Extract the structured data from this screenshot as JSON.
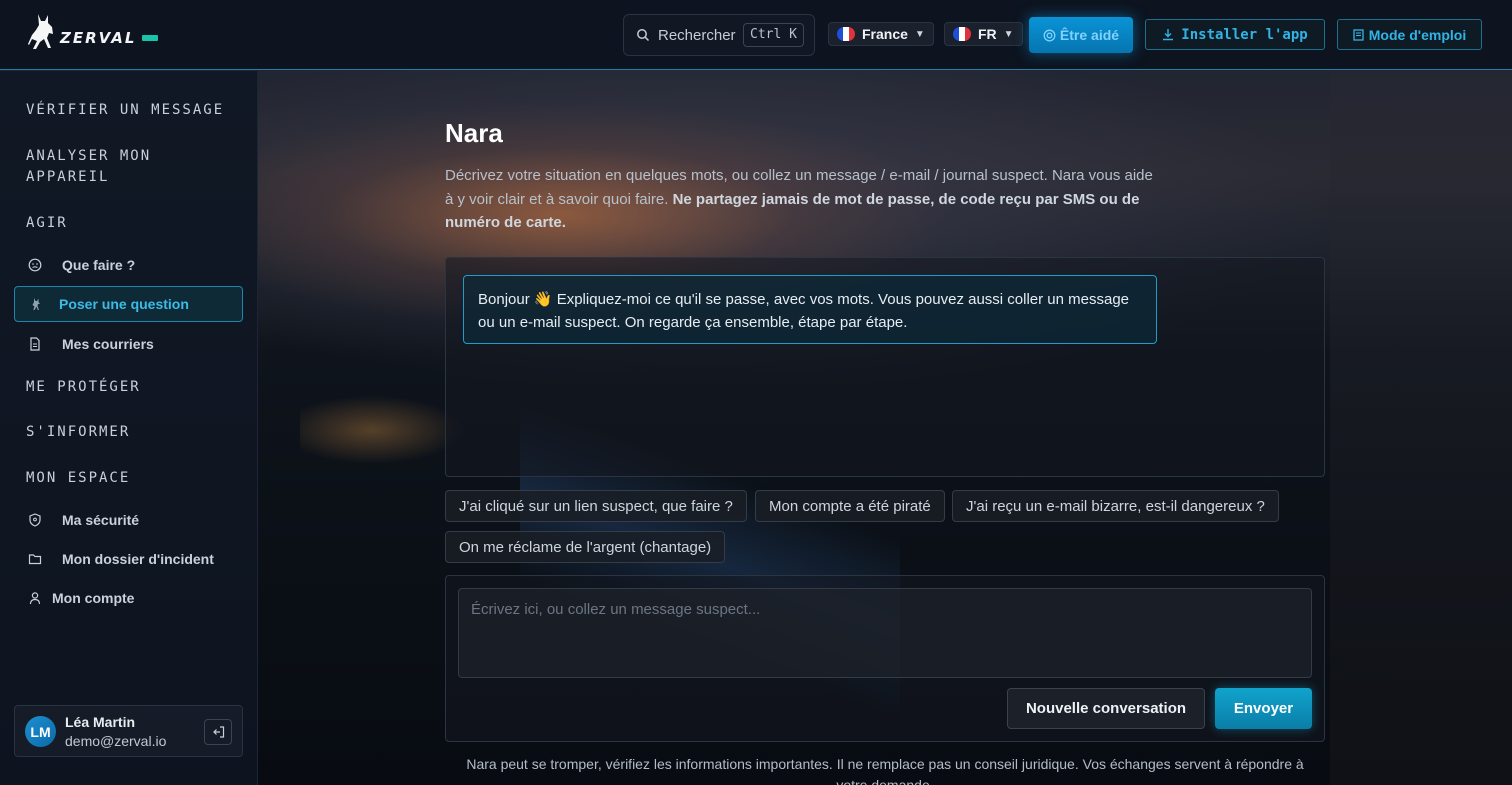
{
  "header": {
    "brand": "ZERVAL",
    "search": {
      "label": "Rechercher",
      "shortcut": "Ctrl K"
    },
    "country": {
      "label": "France",
      "flag": [
        "#1e4fd8",
        "#ffffff",
        "#e2323a"
      ]
    },
    "language": {
      "label": "FR",
      "flag": [
        "#1e4fd8",
        "#ffffff",
        "#e2323a"
      ]
    },
    "help_button": "Être aidé",
    "install_button": "Installer l'app",
    "manual_button": "Mode d'emploi"
  },
  "sidebar": {
    "sections": {
      "verify": "VÉRIFIER UN MESSAGE",
      "analyze_line1": "ANALYSER MON",
      "analyze_line2": "APPAREIL",
      "act": "AGIR",
      "protect": "ME PROTÉGER",
      "inform": "S'INFORMER",
      "space": "MON ESPACE"
    },
    "items": {
      "what_to_do": "Que faire ?",
      "ask_question": "Poser une question",
      "my_mail": "Mes courriers",
      "my_security": "Ma sécurité",
      "incident_file": "Mon dossier d'incident",
      "my_account": "Mon compte"
    },
    "user": {
      "initials": "LM",
      "name": "Léa Martin",
      "email": "demo@zerval.io"
    }
  },
  "main": {
    "title": "Nara",
    "intro": "Décrivez votre situation en quelques mots, ou collez un message / e-mail / journal suspect. Nara vous aide à y voir clair et à savoir quoi faire. ",
    "intro_bold": "Ne partagez jamais de mot de passe, de code reçu par SMS ou de numéro de carte.",
    "bot_message": "Bonjour 👋 Expliquez-moi ce qu'il se passe, avec vos mots. Vous pouvez aussi coller un message ou un e-mail suspect. On regarde ça ensemble, étape par étape.",
    "suggestions": [
      "J'ai cliqué sur un lien suspect, que faire ?",
      "Mon compte a été piraté",
      "J'ai reçu un e-mail bizarre, est-il dangereux ?",
      "On me réclame de l'argent (chantage)"
    ],
    "composer": {
      "placeholder": "Écrivez ici, ou collez un message suspect...",
      "new_button": "Nouvelle conversation",
      "send_button": "Envoyer"
    },
    "disclaimer": "Nara peut se tromper, vérifiez les informations importantes. Il ne remplace pas un conseil juridique. Vos échanges servent à répondre à votre demande."
  },
  "colors": {
    "accent": "#1d86ac",
    "primary_button": "#0a93d6",
    "brand_badge": "#19c3a8"
  }
}
